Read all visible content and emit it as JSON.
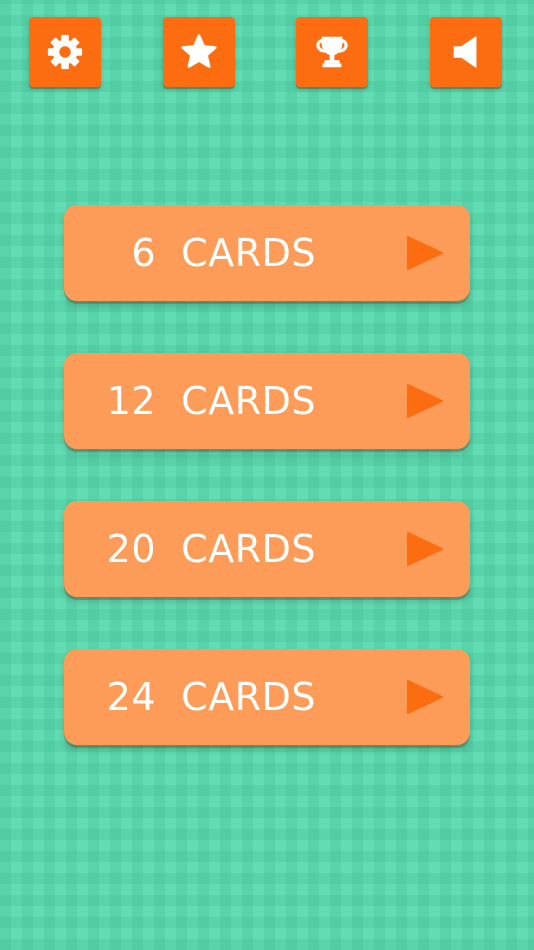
{
  "colors": {
    "background": "#62dcb3",
    "icon_button": "#fb6d10",
    "mode_button": "#fd9c58",
    "play_arrow": "#fb6d10",
    "text": "#ffffff"
  },
  "top_bar": {
    "buttons": [
      {
        "id": "settings",
        "icon": "gear-icon"
      },
      {
        "id": "rate",
        "icon": "star-icon"
      },
      {
        "id": "leaderboard",
        "icon": "trophy-icon"
      },
      {
        "id": "sound",
        "icon": "speaker-icon"
      }
    ]
  },
  "modes": [
    {
      "count": "6",
      "label": "CARDS",
      "icon": "play-icon"
    },
    {
      "count": "12",
      "label": "CARDS",
      "icon": "play-icon"
    },
    {
      "count": "20",
      "label": "CARDS",
      "icon": "play-icon"
    },
    {
      "count": "24",
      "label": "CARDS",
      "icon": "play-icon"
    }
  ]
}
